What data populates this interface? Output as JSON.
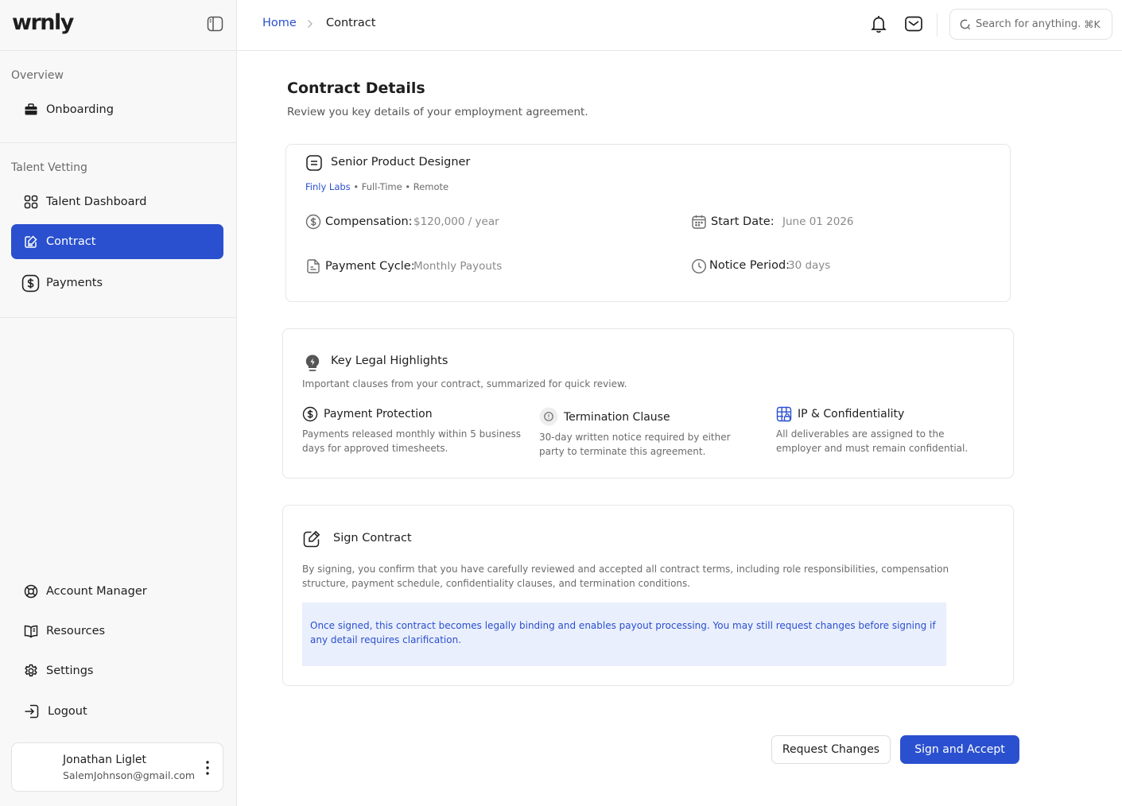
{
  "app": {
    "logo": "wrnly"
  },
  "sidebar": {
    "sections": [
      {
        "label": "Overview",
        "items": [
          {
            "label": "Onboarding",
            "icon": "briefcase-icon"
          }
        ]
      },
      {
        "label": "Talent Vetting",
        "items": [
          {
            "label": "Talent Dashboard",
            "icon": "dashboard-icon"
          },
          {
            "label": "Contract",
            "icon": "contract-icon",
            "active": true
          },
          {
            "label": "Payments",
            "icon": "dollar-icon"
          }
        ]
      }
    ],
    "bottom_items": [
      {
        "label": "Account Manager",
        "icon": "lifebuoy-icon"
      },
      {
        "label": "Resources",
        "icon": "book-icon"
      },
      {
        "label": "Settings",
        "icon": "gear-icon"
      },
      {
        "label": "Logout",
        "icon": "logout-icon"
      }
    ],
    "user": {
      "name": "Jonathan Liglet",
      "email": "SalemJohnson@gmail.com"
    }
  },
  "header": {
    "breadcrumb": {
      "home": "Home",
      "current": "Contract"
    },
    "search": {
      "placeholder": "Search for anything...",
      "shortcut": "⌘K"
    }
  },
  "page": {
    "title": "Contract Details",
    "subtitle": "Review you key details of your employment agreement."
  },
  "contract": {
    "job_title": "Senior Product Designer",
    "company": "Finly Labs",
    "meta": "• Full-Time • Remote",
    "compensation": {
      "label": "Compensation:",
      "value": "$120,000 / year"
    },
    "start_date": {
      "label": "Start Date:",
      "value": "June 01 2026"
    },
    "payment_cycle": {
      "label": "Payment Cycle:",
      "value": "Monthly Payouts"
    },
    "notice_period": {
      "label": "Notice Period:",
      "value": "30 days"
    }
  },
  "legal": {
    "title": "Key Legal Highlights",
    "description": "Important clauses from your contract, summarized for quick review.",
    "highlights": [
      {
        "title": "Payment Protection",
        "text": "Payments released monthly within 5 business days for approved timesheets.",
        "icon": "dollar-icon"
      },
      {
        "title": "Termination Clause",
        "text": "30-day written notice required by either party to terminate this agreement.",
        "icon": "alert-circle-icon"
      },
      {
        "title": "IP & Confidentiality",
        "text": "All deliverables are assigned to the employer and must remain confidential.",
        "icon": "grid-lock-icon"
      }
    ]
  },
  "sign": {
    "title": "Sign Contract",
    "description": "By signing, you confirm that you have carefully reviewed and accepted all contract terms, including role responsibilities, compensation structure, payment schedule, confidentiality clauses, and termination conditions.",
    "notice": "Once signed, this contract becomes legally binding and enables payout processing. You may still request changes before signing if any detail requires clarification."
  },
  "actions": {
    "request_changes": "Request Changes",
    "sign_accept": "Sign and Accept"
  },
  "colors": {
    "accent": "#2a50cf",
    "notice_bg": "#eaeffd"
  }
}
